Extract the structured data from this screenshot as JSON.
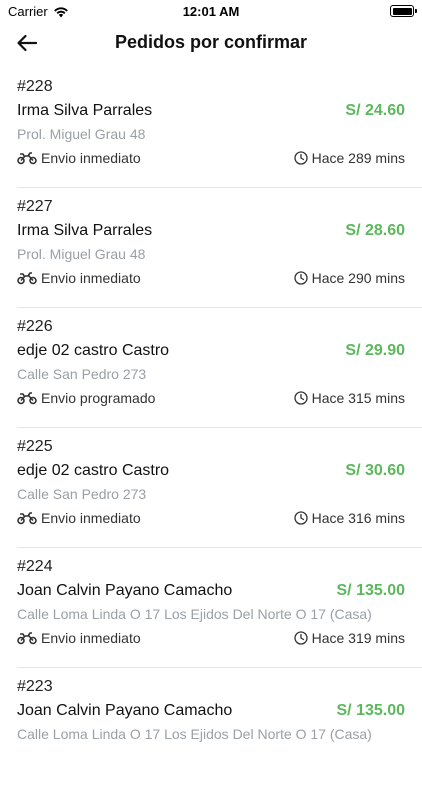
{
  "status_bar": {
    "carrier": "Carrier",
    "time": "12:01 AM",
    "icons": [
      "wifi-icon",
      "battery-icon"
    ]
  },
  "header": {
    "title": "Pedidos por confirmar",
    "back_icon": "arrow-left-icon"
  },
  "colors": {
    "price": "#5cb85c",
    "address": "#9aa0a6",
    "divider": "#e6e6e6"
  },
  "orders": [
    {
      "number": "#228",
      "customer": "Irma Silva Parrales",
      "price": "S/ 24.60",
      "address": "Prol. Miguel Grau 48",
      "shipping": "Envio inmediato",
      "elapsed": "Hace 289 mins"
    },
    {
      "number": "#227",
      "customer": "Irma Silva Parrales",
      "price": "S/ 28.60",
      "address": "Prol. Miguel Grau 48",
      "shipping": "Envio inmediato",
      "elapsed": "Hace 290 mins"
    },
    {
      "number": "#226",
      "customer": "edje 02  castro Castro",
      "price": "S/ 29.90",
      "address": "Calle San Pedro 273",
      "shipping": "Envio programado",
      "elapsed": "Hace 315 mins"
    },
    {
      "number": "#225",
      "customer": "edje 02  castro Castro",
      "price": "S/ 30.60",
      "address": "Calle San Pedro 273",
      "shipping": "Envio inmediato",
      "elapsed": "Hace 316 mins"
    },
    {
      "number": "#224",
      "customer": "Joan Calvin Payano Camacho",
      "price": "S/ 135.00",
      "address": "Calle Loma Linda O 17 Los Ejidos Del Norte O 17 (Casa)",
      "shipping": "Envio inmediato",
      "elapsed": "Hace 319 mins"
    },
    {
      "number": "#223",
      "customer": "Joan Calvin Payano Camacho",
      "price": "S/ 135.00",
      "address": "Calle Loma Linda O 17 Los Ejidos Del Norte O 17 (Casa)",
      "shipping": "",
      "elapsed": ""
    }
  ]
}
